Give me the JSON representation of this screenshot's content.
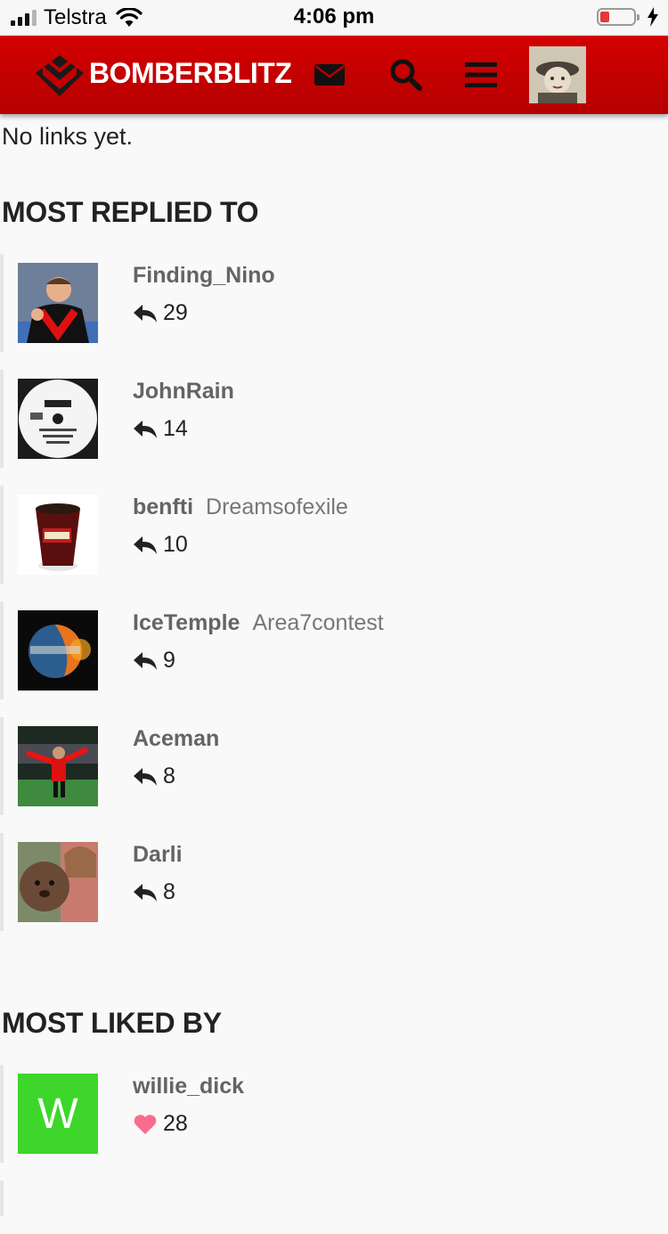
{
  "status_bar": {
    "carrier": "Telstra",
    "time": "4:06 pm"
  },
  "header": {
    "brand": "BOMBERBLITZ"
  },
  "no_links_text": "No links yet.",
  "most_replied": {
    "title": "MOST REPLIED TO",
    "users": [
      {
        "username": "Finding_Nino",
        "user_title": "",
        "count": "29"
      },
      {
        "username": "JohnRain",
        "user_title": "",
        "count": "14"
      },
      {
        "username": "benfti",
        "user_title": "Dreamsofexile",
        "count": "10"
      },
      {
        "username": "IceTemple",
        "user_title": "Area7contest",
        "count": "9"
      },
      {
        "username": "Aceman",
        "user_title": "",
        "count": "8"
      },
      {
        "username": "Darli",
        "user_title": "",
        "count": "8"
      }
    ]
  },
  "most_liked": {
    "title": "MOST LIKED BY",
    "users": [
      {
        "username": "willie_dick",
        "avatar_letter": "W",
        "avatar_color": "#3ed62a",
        "count": "28"
      }
    ]
  },
  "colors": {
    "header_red": "#c40000",
    "like_pink": "#fa6c8d",
    "username_gray": "#646464"
  },
  "icons": [
    "mail-icon",
    "search-icon",
    "hamburger-menu-icon",
    "reply-icon",
    "heart-icon"
  ]
}
